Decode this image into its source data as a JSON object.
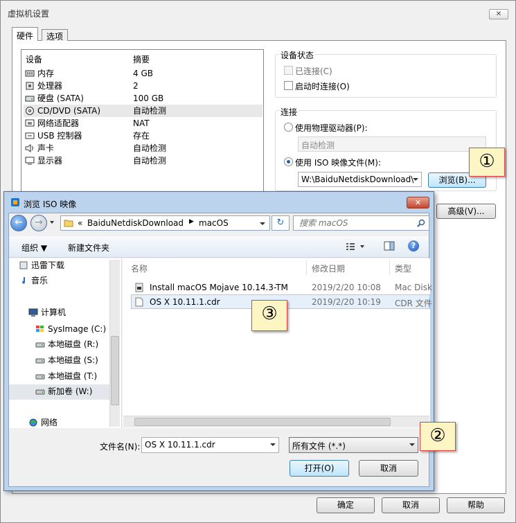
{
  "vm_dialog": {
    "title": "虚拟机设置",
    "close_glyph": "✕",
    "tabs": [
      "硬件",
      "选项"
    ],
    "device_list": {
      "headers": [
        "设备",
        "摘要"
      ],
      "rows": [
        {
          "name": "内存",
          "summary": "4 GB",
          "icon": "memory-icon"
        },
        {
          "name": "处理器",
          "summary": "2",
          "icon": "cpu-icon"
        },
        {
          "name": "硬盘 (SATA)",
          "summary": "100 GB",
          "icon": "harddisk-icon"
        },
        {
          "name": "CD/DVD (SATA)",
          "summary": "自动检测",
          "icon": "cdrom-icon",
          "selected": true
        },
        {
          "name": "网络适配器",
          "summary": "NAT",
          "icon": "network-icon"
        },
        {
          "name": "USB 控制器",
          "summary": "存在",
          "icon": "usb-icon"
        },
        {
          "name": "声卡",
          "summary": "自动检测",
          "icon": "speaker-icon"
        },
        {
          "name": "显示器",
          "summary": "自动检测",
          "icon": "monitor-icon"
        }
      ]
    },
    "device_status": {
      "label": "设备状态",
      "connected": "已连接(C)",
      "connect_at_power_on": "启动时连接(O)"
    },
    "connection": {
      "label": "连接",
      "use_physical": "使用物理驱动器(P):",
      "physical_value": "自动检测",
      "use_iso": "使用 ISO 映像文件(M):",
      "iso_path": "W:\\BaiduNetdiskDownload\\",
      "browse": "浏览(B)..."
    },
    "advanced": "高级(V)...",
    "buttons": {
      "ok": "确定",
      "cancel": "取消",
      "help": "帮助"
    }
  },
  "file_dialog": {
    "title": "浏览 ISO 映像",
    "close_glyph": "✕",
    "breadcrumb": [
      "BaiduNetdiskDownload",
      "macOS"
    ],
    "breadcrumb_prefix": "«",
    "search_placeholder": "搜索 macOS",
    "toolbar": {
      "organize": "组织 ▼",
      "new_folder": "新建文件夹"
    },
    "nav": [
      "迅雷下载",
      "音乐",
      "计算机",
      "SysImage (C:)",
      "本地磁盘 (R:)",
      "本地磁盘 (S:)",
      "本地磁盘 (T:)",
      "新加卷 (W:)",
      "网络"
    ],
    "columns": [
      "名称",
      "修改日期",
      "类型"
    ],
    "files": [
      {
        "name": "Install macOS Mojave 10.14.3-TM",
        "date": "2019/2/20 10:08",
        "type": "Mac Disk"
      },
      {
        "name": "OS X 10.11.1.cdr",
        "date": "2019/2/20 10:19",
        "type": "CDR 文件"
      }
    ],
    "filename_label": "文件名(N):",
    "filename_value": "OS X 10.11.1.cdr",
    "filetype_value": "所有文件 (*.*)",
    "open": "打开(O)",
    "cancel": "取消"
  },
  "callouts": [
    "①",
    "②",
    "③"
  ]
}
